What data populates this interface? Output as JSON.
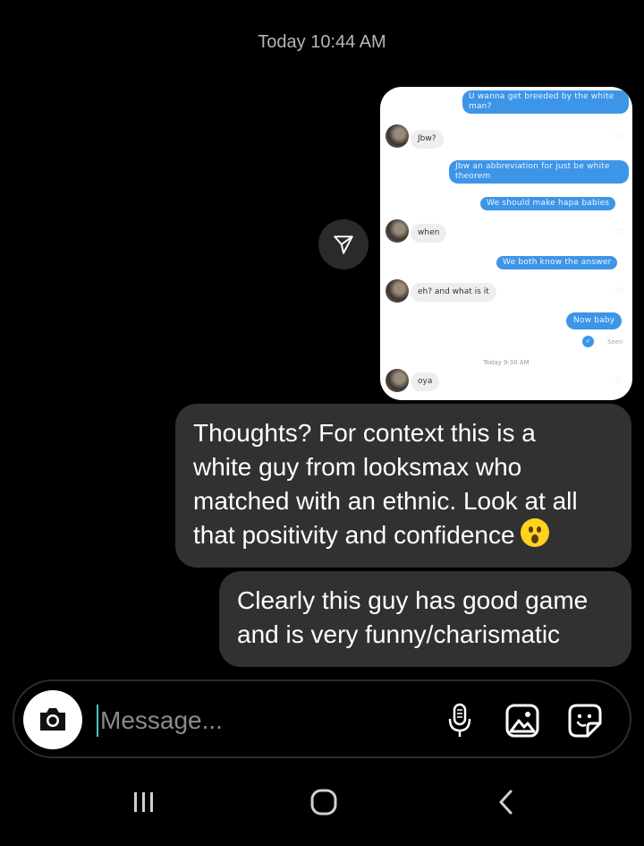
{
  "header": {
    "timestamp": "Today 10:44 AM"
  },
  "shared_image": {
    "messages": [
      {
        "from": "sent",
        "text": "U wanna get breeded by the white man?"
      },
      {
        "from": "received",
        "text": "Jbw?"
      },
      {
        "from": "sent",
        "text": "Jbw an abbreviation for just be white theorem"
      },
      {
        "from": "sent",
        "text": "We should make hapa babies"
      },
      {
        "from": "received",
        "text": "when"
      },
      {
        "from": "sent",
        "text": "We both know the answer"
      },
      {
        "from": "received",
        "text": "eh? and what is it"
      },
      {
        "from": "sent",
        "text": "Now baby"
      },
      {
        "from": "received",
        "text": "oya"
      }
    ],
    "seen_label": "Seen",
    "time_label": "Today 9:30 AM"
  },
  "chat": {
    "bubble1_lines": [
      "Thoughts? For context this is a",
      "white guy from looksmax who",
      "matched with an ethnic. Look at all",
      "that positivity and confidence"
    ],
    "bubble1_emoji": "hushed-face-emoji",
    "bubble2_lines": [
      "Clearly this guy has good game",
      "and is very funny/charismatic"
    ]
  },
  "composer": {
    "placeholder": "Message...",
    "value": ""
  },
  "icons": {
    "share": "paper-plane-icon",
    "camera": "camera-icon",
    "mic": "microphone-icon",
    "gallery": "image-icon",
    "sticker": "sticker-icon",
    "nav_recents": "recents-icon",
    "nav_home": "home-icon",
    "nav_back": "back-icon"
  },
  "colors": {
    "background": "#000000",
    "bubble": "#313131",
    "accent_blue": "#3d95e8",
    "caret": "#4fc3c8"
  }
}
